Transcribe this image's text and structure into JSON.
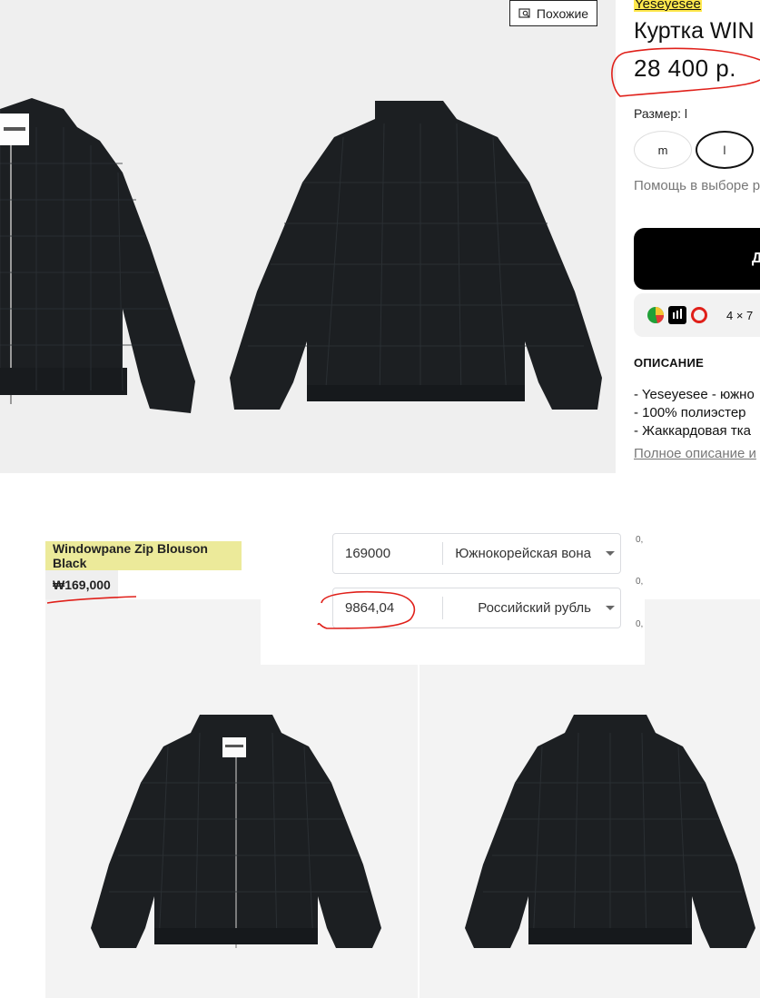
{
  "similar_button": {
    "label": "Похожие",
    "icon": "image-search-icon"
  },
  "product": {
    "brand": "Yeseyesee",
    "title": "Куртка WIN",
    "price": "28 400 р.",
    "size_label": "Размер: l",
    "sizes": [
      "m",
      "l"
    ],
    "selected_size": "l",
    "size_help": "Помощь в выборе р",
    "add_button_label": "Д",
    "bnpl_text": "4 × 7",
    "description_heading": "ОПИСАНИЕ",
    "description_lines": [
      "- Yeseyesee - южно",
      "- 100% полиэстер",
      "- Жаккардовая тка"
    ],
    "full_description_link": "Полное описание и"
  },
  "converter": {
    "from_value": "169000",
    "from_currency": "Южнокорейская вона",
    "to_value": "9864,04",
    "to_currency": "Российский рубль",
    "side_marks": [
      "0,",
      "0,",
      "0,"
    ]
  },
  "listing": {
    "title": "Windowpane Zip Blouson Black",
    "price": "₩169,000"
  },
  "colors": {
    "highlight": "#ffe84d",
    "listing_title_bg": "#ecea9a",
    "annotation_red": "#e0201a",
    "jacket": "#1c1f22"
  }
}
